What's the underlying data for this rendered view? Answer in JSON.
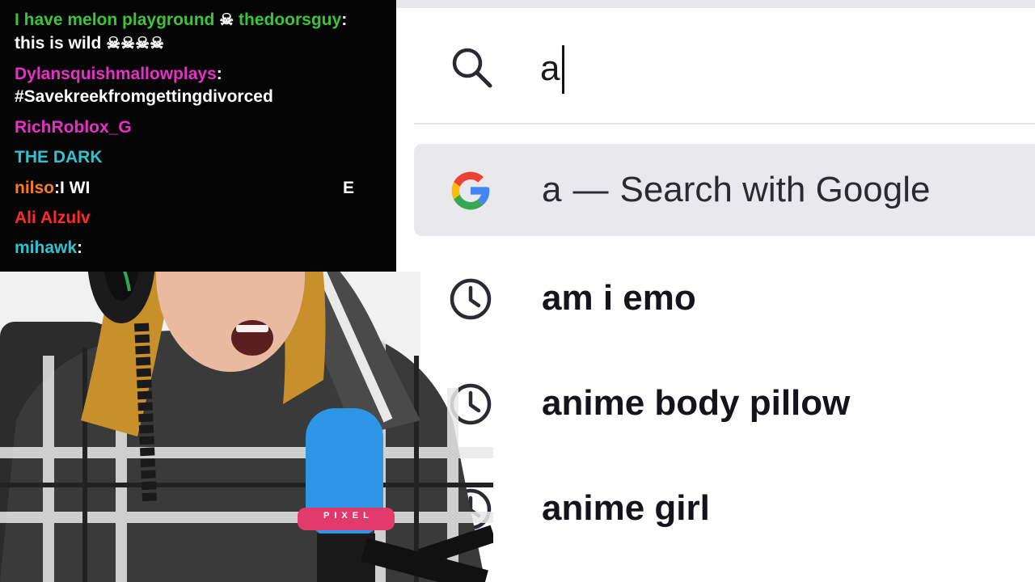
{
  "chat": {
    "messages": [
      {
        "user": "I have melon playground",
        "text": "",
        "user_color": "#3ac537",
        "skulls": 1
      },
      {
        "user": "thedoorsguy",
        "text": "this is wild",
        "user_color": "#3ac537",
        "skulls": 4
      },
      {
        "user": "Dylansquishmallowplays",
        "text": "#Savekreekfromgettingdivorced",
        "user_color": "#e830c8"
      },
      {
        "user": "RichRoblox_G",
        "text": "",
        "user_color": "#e830c8"
      },
      {
        "user": "",
        "text": "THE DARK",
        "user_color": "#2fc3cf"
      },
      {
        "user": "nilso",
        "text": "I WI",
        "user_color": "#ff7a1a",
        "extra": "E"
      },
      {
        "user": "Ali Alzulv",
        "text": "",
        "user_color": "#ff2a2a"
      },
      {
        "user": "mihawk",
        "text": "",
        "user_color": "#2fc3cf"
      }
    ]
  },
  "search": {
    "query": "a",
    "icon": "search-icon"
  },
  "suggestions": [
    {
      "icon": "google-icon",
      "query": "a",
      "separator": "—",
      "engine_label": "Search with Google",
      "selected": true
    },
    {
      "icon": "history-clock-icon",
      "text": "am i emo"
    },
    {
      "icon": "history-clock-icon",
      "text": "anime body pillow"
    },
    {
      "icon": "history-clock-icon",
      "text": "anime girl"
    }
  ],
  "mic_beads": "PIXEL",
  "colors": {
    "panel_bg": "#ffffff",
    "selected_bg": "#e8e8ed",
    "chat_bg": "#050505",
    "mic_foam": "#2d96e6",
    "google_blue": "#4285F4",
    "google_red": "#EA4335",
    "google_yellow": "#FBBC05",
    "google_green": "#34A853"
  }
}
